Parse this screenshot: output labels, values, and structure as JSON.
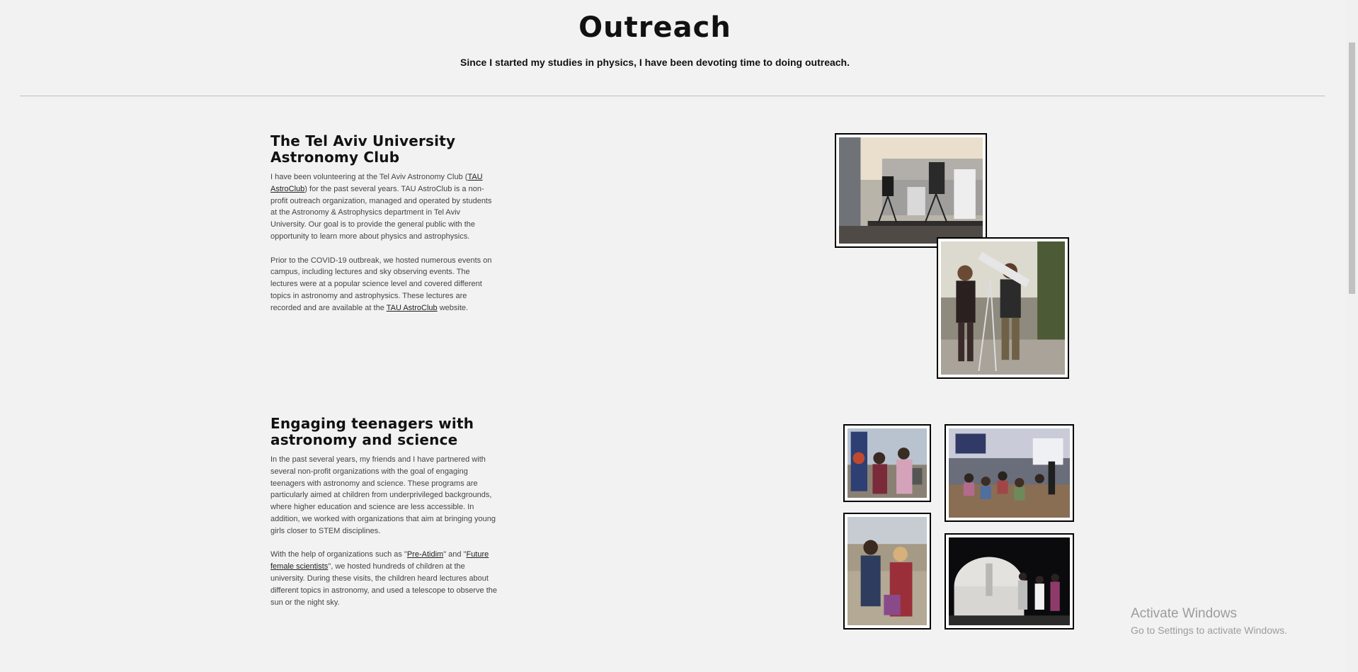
{
  "header": {
    "title": "Outreach",
    "subtitle": "Since I started my studies in physics, I have been devoting time to doing outreach."
  },
  "sections": [
    {
      "title_line1": "The Tel Aviv University",
      "title_line2": "Astronomy Club",
      "p1_a": "I have been volunteering at the Tel Aviv Astronomy Club (",
      "p1_link": "TAU AstroClub",
      "p1_b": ") for the past several years. TAU AstroClub is a non-profit outreach organization, managed and operated by students at the Astronomy & Astrophysics department in Tel Aviv University. Our goal is to provide the general public with the opportunity to learn more about physics and astrophysics.",
      "p2_a": "Prior to the COVID-19 outbreak, we hosted numerous events on campus, including lectures and sky observing events. The lectures were at a popular science level and covered different topics in astronomy and astrophysics. These lectures are recorded and are available at the ",
      "p2_link": "TAU AstroClub",
      "p2_b": " website."
    },
    {
      "title_line1": "Engaging teenagers with",
      "title_line2": "astronomy and science",
      "p1": "In the past several years, my friends and I have partnered with several non-profit organizations with the goal of engaging teenagers with astronomy and science. These programs are particularly aimed at children from underprivileged backgrounds, where higher education and science are less accessible. In addition, we worked with organizations that aim at bringing young girls closer to STEM disciplines.",
      "p2_a": "With the help of organizations such as \"",
      "p2_link1": "Pre-Atidim",
      "p2_b": "\" and \"",
      "p2_link2": "Future female scientists",
      "p2_c": "\", we hosted hundreds of children at the university. During these visits, the children heard lectures about different topics in astronomy, and used a telescope to observe the sun or the night sky."
    }
  ],
  "photos": [
    {
      "icon": "telescopes-photo"
    },
    {
      "icon": "people-with-telescope-photo"
    },
    {
      "icon": "students-outdoor-photo"
    },
    {
      "icon": "classroom-photo"
    },
    {
      "icon": "girls-looking-photo"
    },
    {
      "icon": "observatory-night-photo"
    }
  ],
  "watermark": {
    "title": "Activate Windows",
    "subtitle": "Go to Settings to activate Windows."
  }
}
